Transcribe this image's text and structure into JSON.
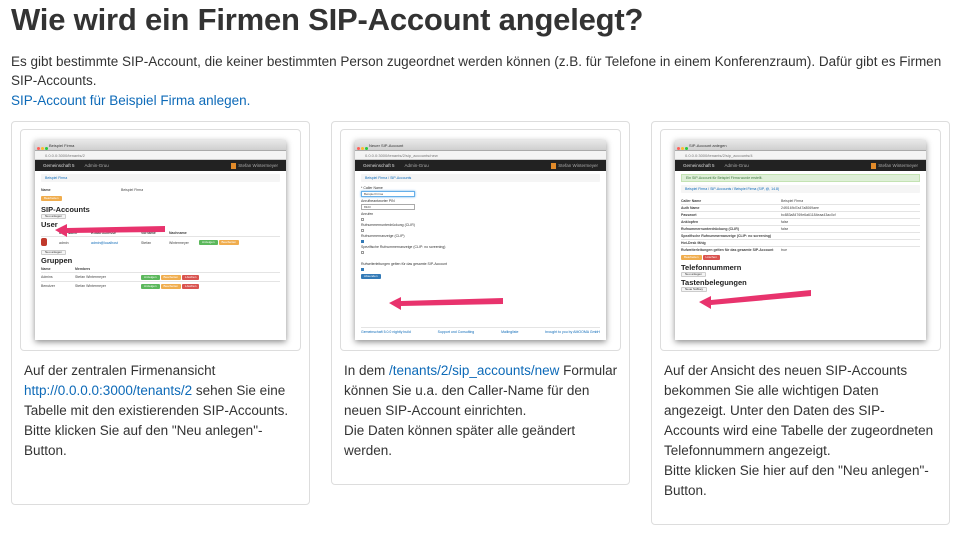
{
  "page": {
    "title": "Wie wird ein Firmen SIP-Account angelegt?",
    "intro": "Es gibt bestimmte SIP-Account, die keiner bestimmten Person zugeordnet werden können (z.B. für Telefone in einem Konferenzraum). Dafür gibt es Firmen SIP-Accounts.",
    "intro_link": "SIP-Account für Beispiel Firma anlegen."
  },
  "cards": [
    {
      "caption_before": "Auf der zentralen Firmenansicht ",
      "caption_link": "http://0.0.0.0:3000/tenants/2",
      "caption_after": " sehen Sie eine Tabelle mit den existierenden SIP-Accounts.",
      "caption_line2": "Bitte klicken Sie auf den \"Neu anlegen\"-Button.",
      "shot": {
        "tab": "Beispiel Firma",
        "url": "0.0.0.0:3000/tenants/2",
        "brand": "Gemeinschaft 5",
        "nav": "Admin-Gruu",
        "user": "Stefan Wintermeyer",
        "crumb": "Beispiel Firma",
        "name_label": "Name",
        "name_value": "Beispiel Firma",
        "edit": "Bearbeiten",
        "h_sip": "SIP-Accounts",
        "new": "Neu anlegen",
        "h_user": "User",
        "user_cols": [
          "User Name",
          "E-Mail Adresse",
          "Vorname",
          "Nachname"
        ],
        "user_row": [
          "admin",
          "admin@localhost",
          "Stefan",
          "Wintermeyer"
        ],
        "btn_show": "Anzeigen",
        "btn_edit": "Bearbeiten",
        "btn_del": "Löschen",
        "h_groups": "Gruppen",
        "group_cols": [
          "Name",
          "Members"
        ],
        "group_rows": [
          [
            "Admins",
            "Stefan Wintermeyer"
          ],
          [
            "Benutzer",
            "Stefan Wintermeyer"
          ]
        ]
      }
    },
    {
      "caption_before": "In dem ",
      "caption_link": "/tenants/2/sip_accounts/new",
      "caption_after": " Formular können Sie u.a. den Caller-Name für den neuen SIP-Account einrichten.",
      "caption_line2": "Die Daten können später alle geändert werden.",
      "shot": {
        "tab": "Neuer SIP-Account",
        "url": "0.0.0.0:3000/tenants/2/sip_accounts/new",
        "brand": "Gemeinschaft 5",
        "nav": "Admin-Gruu",
        "user": "Stefan Wintermeyer",
        "crumb": "Beispiel Firma / SIP-Accounts",
        "f_caller": "* Caller Name",
        "f_caller_val": "Beispiel Firma",
        "f_pin": "Anrufbeantworter PIN",
        "f_pin_val": "8323",
        "f_on": "Anrufen",
        "f_clir": "Rufnummernunterdrückung (CLIR)",
        "f_clip": "Rufnummernanzeige (CLIP)",
        "f_clip_ns": "Spezifische Rufnummernanzeige (CLIP: no screening)",
        "f_fwd": "Rufweiterleitungen gelten für das gesamte SIP-Account",
        "submit": "Absenden",
        "footer_left": "Gemeinschaft 5.0.0 nightly build",
        "footer_mid1": "Support und Consulting",
        "footer_mid2": "Mailingliste",
        "footer_right": "brought to you by AMOOMA GmbH"
      }
    },
    {
      "caption_before": "",
      "caption_link": "",
      "caption_after": "Auf der Ansicht des neuen SIP-Accounts bekommen Sie alle wichtigen Daten angezeigt. Unter den Daten des SIP-Accounts wird eine Tabelle der zugeordneten Telefonnummern angezeigt.",
      "caption_line2": "Bitte klicken Sie hier auf den \"Neu anlegen\"-Button.",
      "shot": {
        "tab": "SIP-Account anlegen",
        "url": "0.0.0.0:3000/tenants/2/sip_accounts/4",
        "brand": "Gemeinschaft 5",
        "nav": "Admin-Gruu",
        "user": "Stefan Wintermeyer",
        "alert": "Ein SIP-Account für Beispiel Firma wurde erstellt.",
        "crumb": "Beispiel Firma / SIP-Accounts / Beispiel Firma (SIP, @, 14.8)",
        "rows": [
          [
            "Caller Name",
            "Beispiel Firma"
          ],
          [
            "Auth Name",
            "24f0169d7a47a8069aee"
          ],
          [
            "Passwort",
            "bc883a84769e6a61184eaa43ac0cf"
          ],
          [
            "Anklopfen",
            "false"
          ],
          [
            "Rufnummernunterdrückung (CLIR)",
            "false"
          ],
          [
            "Spezifische Rufnummernanzeige (CLIP: no screening) ",
            ""
          ],
          [
            "Hot-Desk fähig",
            ""
          ],
          [
            "Rufweiterleitungen gelten für das gesamte SIP-Account",
            "true"
          ]
        ],
        "edit": "Bearbeiten",
        "del": "Löschen",
        "h_numbers": "Telefonnummern",
        "new": "Neu anlegen",
        "h_keys": "Tastenbelegungen",
        "new_key": "Neue Softkey"
      }
    }
  ],
  "colors": {
    "link": "#0d6ab8",
    "arrow": "#e8336d",
    "title": "#333333"
  }
}
